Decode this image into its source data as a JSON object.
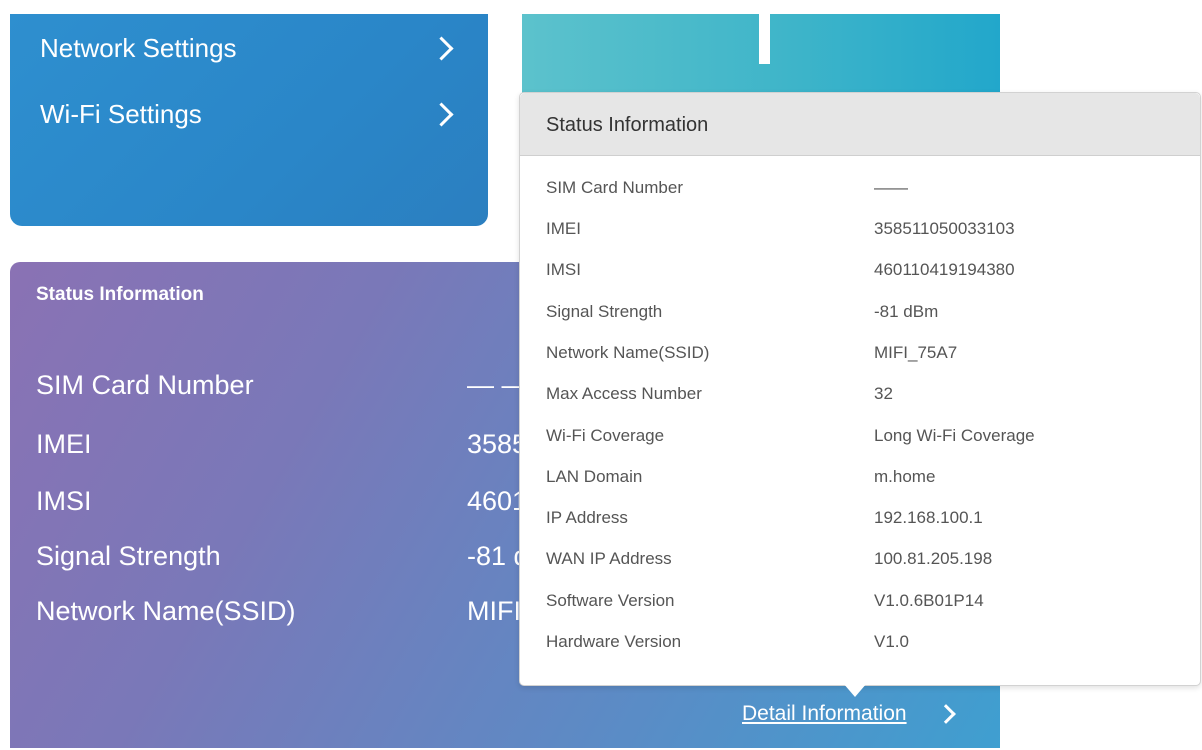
{
  "settings_menu": {
    "items": [
      {
        "label": "Network Settings"
      },
      {
        "label": "Wi-Fi Settings"
      }
    ]
  },
  "status_card": {
    "title": "Status Information",
    "rows": [
      {
        "label": "SIM Card Number",
        "value": "— —"
      },
      {
        "label": "IMEI",
        "value": "358511050033103"
      },
      {
        "label": "IMSI",
        "value": "460110419194380"
      },
      {
        "label": "Signal Strength",
        "value": "-81 dBm"
      },
      {
        "label": "Network Name(SSID)",
        "value": "MIFI_75A7"
      }
    ],
    "detail_link": "Detail Information"
  },
  "popup": {
    "title": "Status Information",
    "rows": [
      {
        "label": "SIM Card Number",
        "value": "——"
      },
      {
        "label": "IMEI",
        "value": "358511050033103"
      },
      {
        "label": "IMSI",
        "value": "460110419194380"
      },
      {
        "label": "Signal Strength",
        "value": "-81 dBm"
      },
      {
        "label": "Network Name(SSID)",
        "value": "MIFI_75A7"
      },
      {
        "label": "Max Access Number",
        "value": "32"
      },
      {
        "label": "Wi-Fi Coverage",
        "value": "Long Wi-Fi Coverage"
      },
      {
        "label": "LAN Domain",
        "value": "m.home"
      },
      {
        "label": "IP Address",
        "value": "192.168.100.1"
      },
      {
        "label": "WAN IP Address",
        "value": "100.81.205.198"
      },
      {
        "label": "Software Version",
        "value": "V1.0.6B01P14"
      },
      {
        "label": "Hardware Version",
        "value": "V1.0"
      }
    ]
  },
  "icons": {
    "chevron": "chevron-right-icon"
  }
}
